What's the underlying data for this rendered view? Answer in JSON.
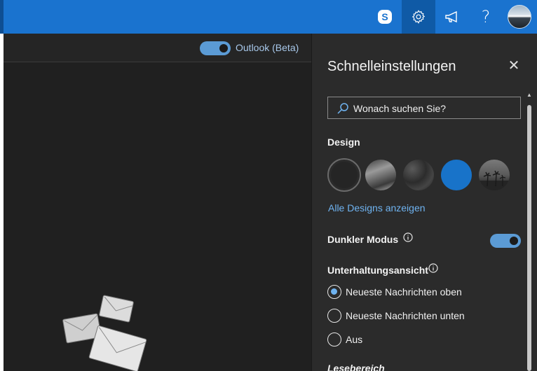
{
  "header": {
    "buttons": [
      {
        "name": "skype",
        "icon": "skype-icon"
      },
      {
        "name": "settings",
        "icon": "gear-icon",
        "active": true
      },
      {
        "name": "feedback",
        "icon": "megaphone-icon"
      },
      {
        "name": "help",
        "icon": "question-icon",
        "glyph": "?"
      },
      {
        "name": "account",
        "icon": "avatar"
      }
    ],
    "brand_color": "#1a73cf"
  },
  "subbar": {
    "beta_label": "Outlook (Beta)",
    "beta_enabled": true
  },
  "quick_settings": {
    "title": "Schnelleinstellungen",
    "close_glyph": "✕",
    "search": {
      "placeholder": "Wonach suchen Sie?"
    },
    "design": {
      "heading": "Design",
      "themes": [
        "black",
        "mountain",
        "texture",
        "blue",
        "palms"
      ],
      "selected": "black",
      "all_link": "Alle Designs anzeigen"
    },
    "dark_mode": {
      "label": "Dunkler Modus",
      "enabled": true
    },
    "conversation_view": {
      "heading": "Unterhaltungsansicht",
      "options": [
        {
          "label": "Neueste Nachrichten oben",
          "checked": true
        },
        {
          "label": "Neueste Nachrichten unten",
          "checked": false
        },
        {
          "label": "Aus",
          "checked": false
        }
      ]
    },
    "reading_pane": {
      "heading": "Lesebereich"
    }
  }
}
